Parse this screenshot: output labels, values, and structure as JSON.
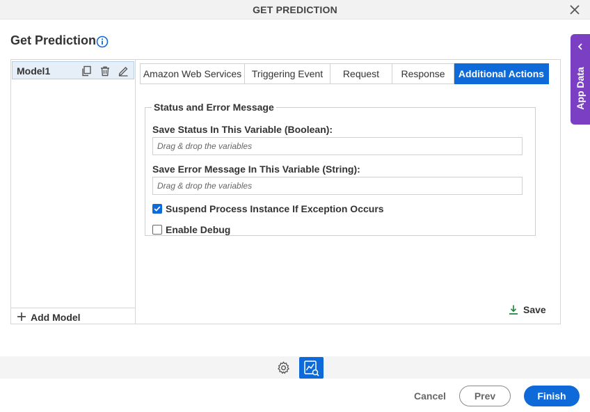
{
  "dialog": {
    "title": "GET PREDICTION"
  },
  "page": {
    "heading": "Get Prediction"
  },
  "app_data": {
    "label": "App Data"
  },
  "models": {
    "items": [
      {
        "name": "Model1"
      }
    ],
    "add_label": "Add Model"
  },
  "tabs": [
    {
      "label": "Amazon Web Services",
      "active": false
    },
    {
      "label": "Triggering Event",
      "active": false
    },
    {
      "label": "Request",
      "active": false
    },
    {
      "label": "Response",
      "active": false
    },
    {
      "label": "Additional Actions",
      "active": true
    }
  ],
  "status_group": {
    "legend": "Status and Error Message",
    "status_var_label": "Save Status In This Variable (Boolean):",
    "status_var_placeholder": "Drag & drop the variables",
    "status_var_value": "",
    "error_var_label": "Save Error Message In This Variable (String):",
    "error_var_placeholder": "Drag & drop the variables",
    "error_var_value": "",
    "suspend_label": "Suspend Process Instance If Exception Occurs",
    "suspend_checked": true,
    "debug_label": "Enable Debug",
    "debug_checked": false
  },
  "save_label": "Save",
  "footer": {
    "cancel": "Cancel",
    "prev": "Prev",
    "finish": "Finish"
  },
  "colors": {
    "primary": "#0d6ad8",
    "app_data": "#7b3fc4",
    "save_icon": "#1e8a3c"
  }
}
